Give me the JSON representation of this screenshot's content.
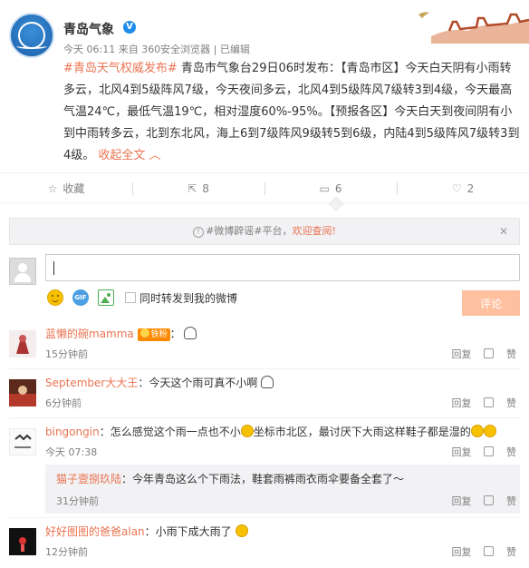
{
  "header": {
    "name": "青岛气象",
    "meta": "今天 06:11 来自 360安全浏览器 | 已编辑",
    "colors": {
      "accent": "#eb7350",
      "verified": "#1f8cec"
    }
  },
  "post": {
    "tag": "#青岛天气权威发布#",
    "text": " 青岛市气象台29日06时发布：【青岛市区】今天白天阴有小雨转多云，北风4到5级阵风7级，今天夜间多云，北风4到5级阵风7级转3到4级，今天最高气温24℃，最低气温19℃，相对湿度60%-95%。【预报各区】今天白天到夜间阴有小到中雨转多云，北到东北风，海上6到7级阵风9级转5到6级，内陆4到5级阵风7级转3到4级。",
    "fold": "收起全文 ︿"
  },
  "actions": {
    "collect": "收藏",
    "repost": "8",
    "comment": "6",
    "like": "2"
  },
  "notice": {
    "prefix": "#微博辟谣#平台，",
    "link": "欢迎查阅!",
    "close": "✕"
  },
  "composer": {
    "also_repost": "同时转发到我的微博",
    "submit": "评论"
  },
  "comments": [
    {
      "user": "蓝懒的碗mamma",
      "badge": "铁粉",
      "text": "：",
      "time": "15分钟前",
      "reply": "回复",
      "like": "赞"
    },
    {
      "user": "September大大王",
      "text": "：今天这个雨可真不小啊",
      "time": "6分钟前",
      "reply": "回复",
      "like": "赞"
    },
    {
      "user": "bingongin",
      "text": "：怎么感觉这个雨一点也不小",
      "text2": "坐标市北区，最讨厌下大雨这样鞋子都是湿的",
      "time": "今天 07:38",
      "reply": "回复",
      "like": "赞"
    },
    {
      "user": "猫子壹捌玖陆",
      "text": "：今年青岛这么个下雨法，鞋套雨裤雨衣雨伞要备全套了～",
      "time": "31分钟前",
      "reply": "回复",
      "like": "赞"
    },
    {
      "user": "好好图图的爸爸alan",
      "text": "：小雨下成大雨了",
      "time": "12分钟前",
      "reply": "回复",
      "like": "赞"
    }
  ]
}
